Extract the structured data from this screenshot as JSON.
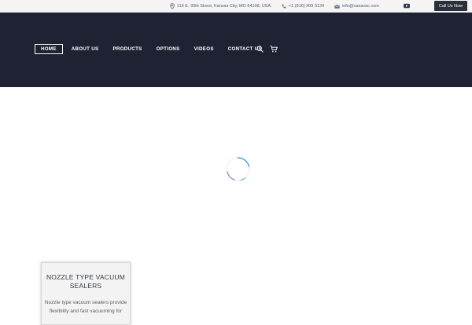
{
  "topbar": {
    "address": "116 E. 30th Street, Kansas City, MO 64108, USA.",
    "phone": "+1 (816) 309 3134",
    "email": "info@nasavac.com",
    "social_icon": "youtube-icon",
    "call_button": "Call Us Now"
  },
  "nav": {
    "items": [
      {
        "label": "HOME",
        "active": true
      },
      {
        "label": "ABOUT US",
        "active": false
      },
      {
        "label": "PRODUCTS",
        "active": false
      },
      {
        "label": "OPTIONS",
        "active": false
      },
      {
        "label": "VIDEOS",
        "active": false
      },
      {
        "label": "CONTACT US",
        "active": false
      }
    ],
    "search_icon": "search-icon",
    "cart_icon": "cart-icon"
  },
  "colors": {
    "header_bg": "#1f2233",
    "topbar_bg": "#f4f4f5",
    "accent": "#4a9fd8"
  },
  "product_card": {
    "title": "NOZZLE TYPE VACUUM SEALERS",
    "description": "Nozzle type vacuum sealers provide flexibility and fast vacuuming for"
  }
}
